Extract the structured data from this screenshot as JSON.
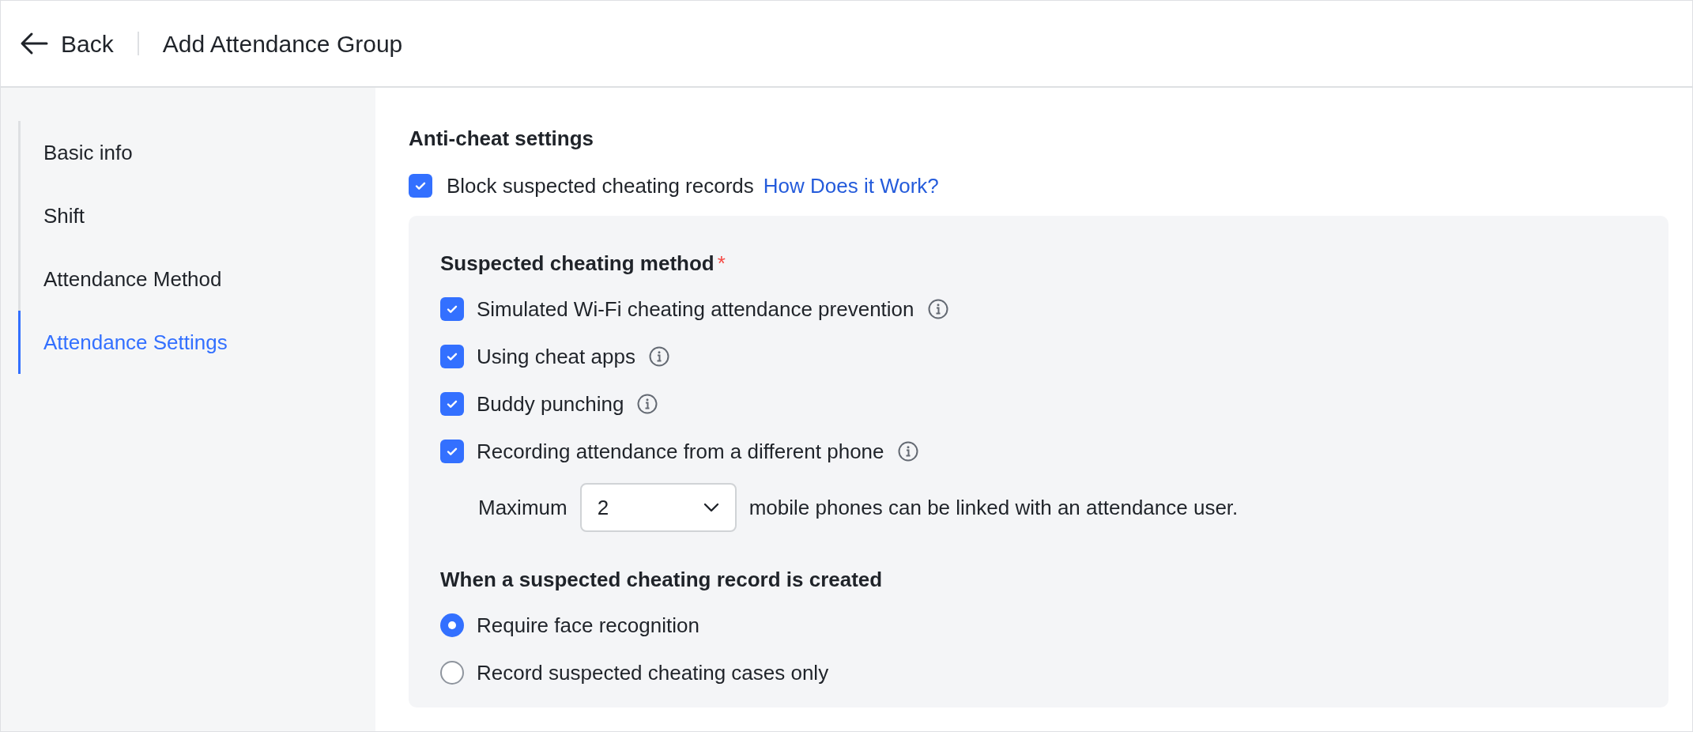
{
  "header": {
    "back": "Back",
    "title": "Add Attendance Group"
  },
  "sidebar": {
    "items": [
      {
        "label": "Basic info",
        "selected": false
      },
      {
        "label": "Shift",
        "selected": false
      },
      {
        "label": "Attendance Method",
        "selected": false
      },
      {
        "label": "Attendance Settings",
        "selected": true
      }
    ]
  },
  "anti_cheat": {
    "title": "Anti-cheat settings",
    "block": {
      "label": "Block suspected cheating records",
      "checked": true,
      "link": "How Does it Work?"
    },
    "method": {
      "title": "Suspected cheating method",
      "required_mark": "*",
      "options": [
        {
          "label": "Simulated Wi-Fi cheating attendance prevention",
          "checked": true
        },
        {
          "label": "Using cheat apps",
          "checked": true
        },
        {
          "label": "Buddy punching",
          "checked": true
        },
        {
          "label": "Recording attendance from a different phone",
          "checked": true
        }
      ]
    },
    "maximum": {
      "prefix": "Maximum",
      "value": "2",
      "suffix": "mobile phones can be linked with an attendance user."
    },
    "when": {
      "title": "When a suspected cheating record is created",
      "options": [
        {
          "label": "Require face recognition",
          "selected": true
        },
        {
          "label": "Record suspected cheating cases only",
          "selected": false
        }
      ]
    }
  }
}
